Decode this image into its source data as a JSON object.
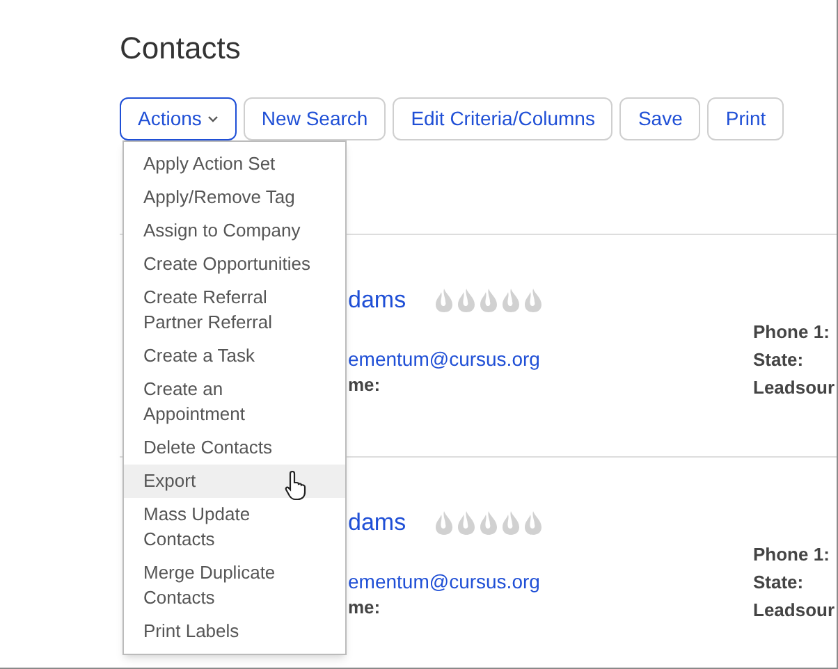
{
  "title": "Contacts",
  "toolbar": [
    {
      "label": "Actions",
      "kind": "dropdown",
      "selected": true
    },
    {
      "label": "New Search",
      "kind": "button",
      "selected": false
    },
    {
      "label": "Edit Criteria/Columns",
      "kind": "button",
      "selected": false
    },
    {
      "label": "Save",
      "kind": "button",
      "selected": false
    },
    {
      "label": "Print",
      "kind": "button",
      "selected": false
    }
  ],
  "actions_menu": [
    {
      "label": "Apply Action Set",
      "selected": false
    },
    {
      "label": "Apply/Remove Tag",
      "selected": false
    },
    {
      "label": "Assign to Company",
      "selected": false
    },
    {
      "label": "Create Opportunities",
      "selected": false
    },
    {
      "label": "Create Referral Partner Referral",
      "selected": false
    },
    {
      "label": "Create a Task",
      "selected": false
    },
    {
      "label": "Create an Appointment",
      "selected": false
    },
    {
      "label": "Delete Contacts",
      "selected": false
    },
    {
      "label": "Export",
      "selected": true
    },
    {
      "label": "Mass Update Contacts",
      "selected": false
    },
    {
      "label": "Merge Duplicate Contacts",
      "selected": false
    },
    {
      "label": "Print Labels",
      "selected": false
    }
  ],
  "contacts": [
    {
      "name": "dams",
      "email": "ementum@cursus.org",
      "left_labels": [
        "me:"
      ],
      "right_labels": [
        "Phone 1:",
        "State:",
        "Leadsour"
      ]
    },
    {
      "name": "dams",
      "email": "ementum@cursus.org",
      "left_labels": [
        "me:"
      ],
      "right_labels": [
        "Phone 1:",
        "State:",
        "Leadsour"
      ]
    }
  ]
}
